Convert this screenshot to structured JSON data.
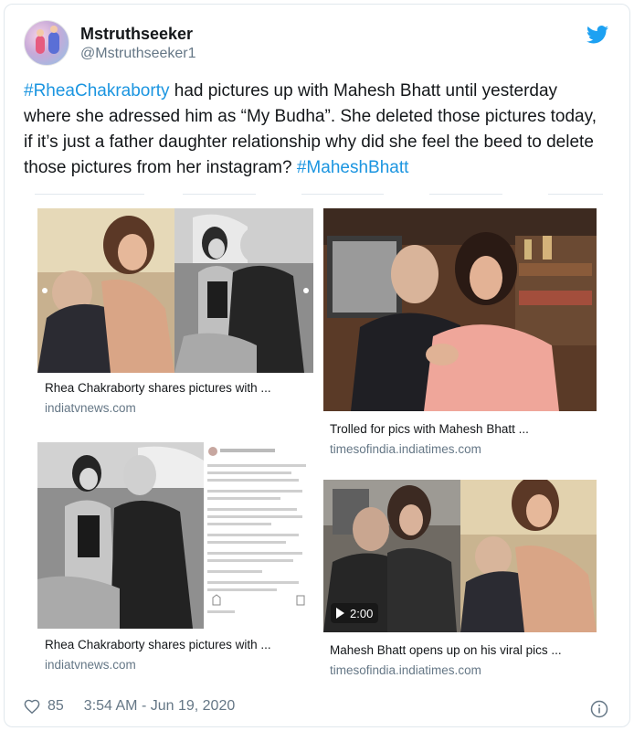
{
  "user": {
    "name": "Mstruthseeker",
    "handle": "@Mstruthseeker1"
  },
  "tweet": {
    "hashtag1": "#RheaChakraborty",
    "body": " had pictures up with Mahesh Bhatt until yesterday where she adressed him as “My Budha”. She deleted those pictures today, if it’s just a father daughter relationship why did she feel the beed to delete those pictures from her instagram? ",
    "hashtag2": "#MaheshBhatt"
  },
  "media": [
    {
      "title": "Rhea Chakraborty shares pictures with ...",
      "source": "indiatvnews.com"
    },
    {
      "title": "Trolled for pics with Mahesh Bhatt ...",
      "source": "timesofindia.indiatimes.com"
    },
    {
      "title": "Rhea Chakraborty shares pictures with ...",
      "source": "indiatvnews.com"
    },
    {
      "title": "Mahesh Bhatt opens up on his viral pics ...",
      "source": "timesofindia.indiatimes.com",
      "duration": "2:00"
    }
  ],
  "footer": {
    "likes": "85",
    "timestamp": "3:54 AM - Jun 19, 2020"
  },
  "colors": {
    "link": "#1b95e0",
    "twitter_blue": "#1da1f2",
    "muted": "#657786"
  },
  "icons": [
    "twitter-bird-icon",
    "heart-icon",
    "info-icon",
    "play-icon"
  ]
}
